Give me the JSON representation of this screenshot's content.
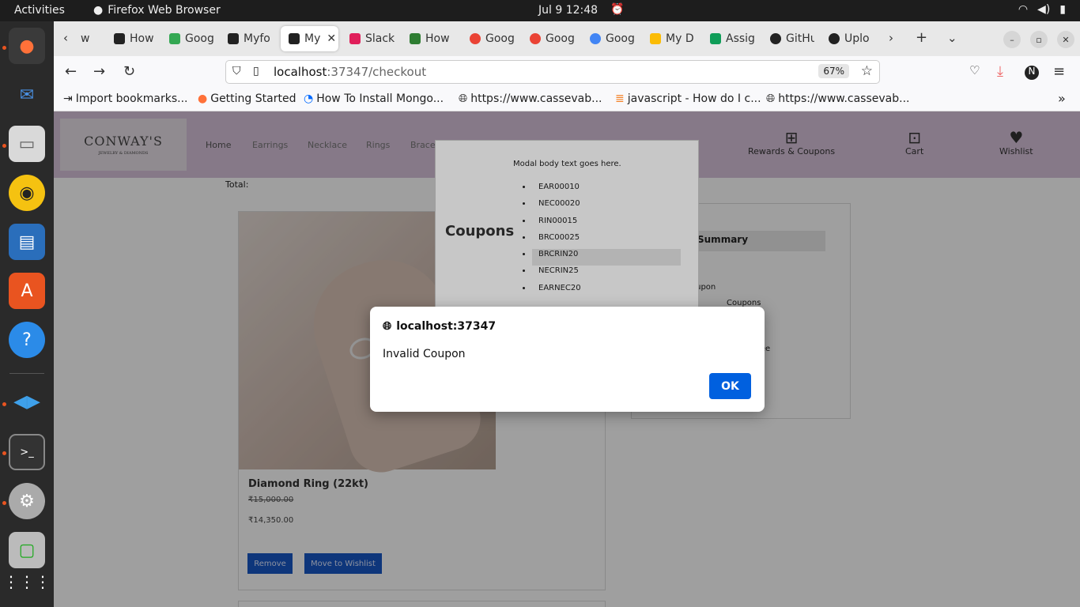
{
  "topbar": {
    "activities": "Activities",
    "app_name": "Firefox Web Browser",
    "clock": "Jul 9  12:48"
  },
  "browser": {
    "tabs": [
      {
        "label": "w",
        "color": "#888"
      },
      {
        "label": "How",
        "color": "#222"
      },
      {
        "label": "Goog",
        "color": "#34a853"
      },
      {
        "label": "Myfo",
        "color": "#222"
      },
      {
        "label": "My",
        "color": "#222"
      },
      {
        "label": "Slack",
        "color": "#e01e5a"
      },
      {
        "label": "How",
        "color": "#2e7d32"
      },
      {
        "label": "Goog",
        "color": "#ea4335"
      },
      {
        "label": "Goog",
        "color": "#ea4335"
      },
      {
        "label": "Goog",
        "color": "#4285f4"
      },
      {
        "label": "My D",
        "color": "#fbbc05"
      },
      {
        "label": "Assig",
        "color": "#0f9d58"
      },
      {
        "label": "GitHu",
        "color": "#222"
      },
      {
        "label": "Uplo",
        "color": "#222"
      }
    ],
    "url_host": "localhost",
    "url_rest": ":37347/checkout",
    "zoom": "67%",
    "bookmarks": [
      "Import bookmarks...",
      "Getting Started",
      "How To Install Mongo...",
      "https://www.cassevab...",
      "javascript - How do I c...",
      "https://www.cassevab..."
    ]
  },
  "site": {
    "logo_main": "CONWAY'S",
    "logo_sub": "JEWELRY & DIAMONDS",
    "nav": [
      "Home",
      "Earrings",
      "Necklace",
      "Rings",
      "Brace"
    ],
    "rewards_label": "Rewards & Coupons",
    "cart_label": "Cart",
    "wishlist_label": "Wishlist",
    "total_label": "Total:",
    "product": {
      "name": "Diamond Ring (22kt)",
      "old_price": "₹15,000.00",
      "new_price": "₹14,350.00",
      "remove_label": "Remove",
      "move_label": "Move to Wishlist"
    },
    "summary": {
      "heading": "Summary",
      "line1": "oupon",
      "line2": "Coupons",
      "line3": ")Free"
    }
  },
  "modal": {
    "title": "Coupons",
    "body": "Modal body text goes here.",
    "coupons": [
      "EAR00010",
      "NEC00020",
      "RIN00015",
      "BRC00025",
      "BRCRIN20",
      "NECRIN25",
      "EARNEC20"
    ],
    "highlighted": "BRCRIN20"
  },
  "alert": {
    "origin": "localhost:37347",
    "message": "Invalid Coupon",
    "ok_label": "OK"
  }
}
